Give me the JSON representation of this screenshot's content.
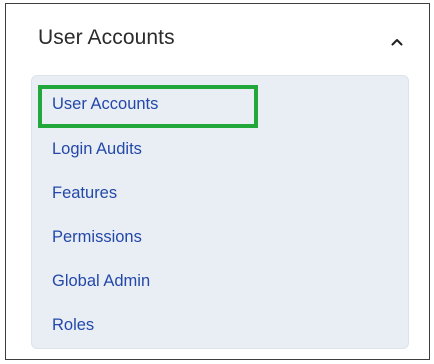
{
  "panel": {
    "title": "User Accounts",
    "collapse_icon": "chevron-up-icon"
  },
  "menu": {
    "items": [
      {
        "label": "User Accounts"
      },
      {
        "label": "Login Audits"
      },
      {
        "label": "Features"
      },
      {
        "label": "Permissions"
      },
      {
        "label": "Global Admin"
      },
      {
        "label": "Roles"
      }
    ]
  },
  "colors": {
    "link": "#2348a8",
    "list_background": "#e9eef5",
    "highlight": "#22a83a"
  }
}
